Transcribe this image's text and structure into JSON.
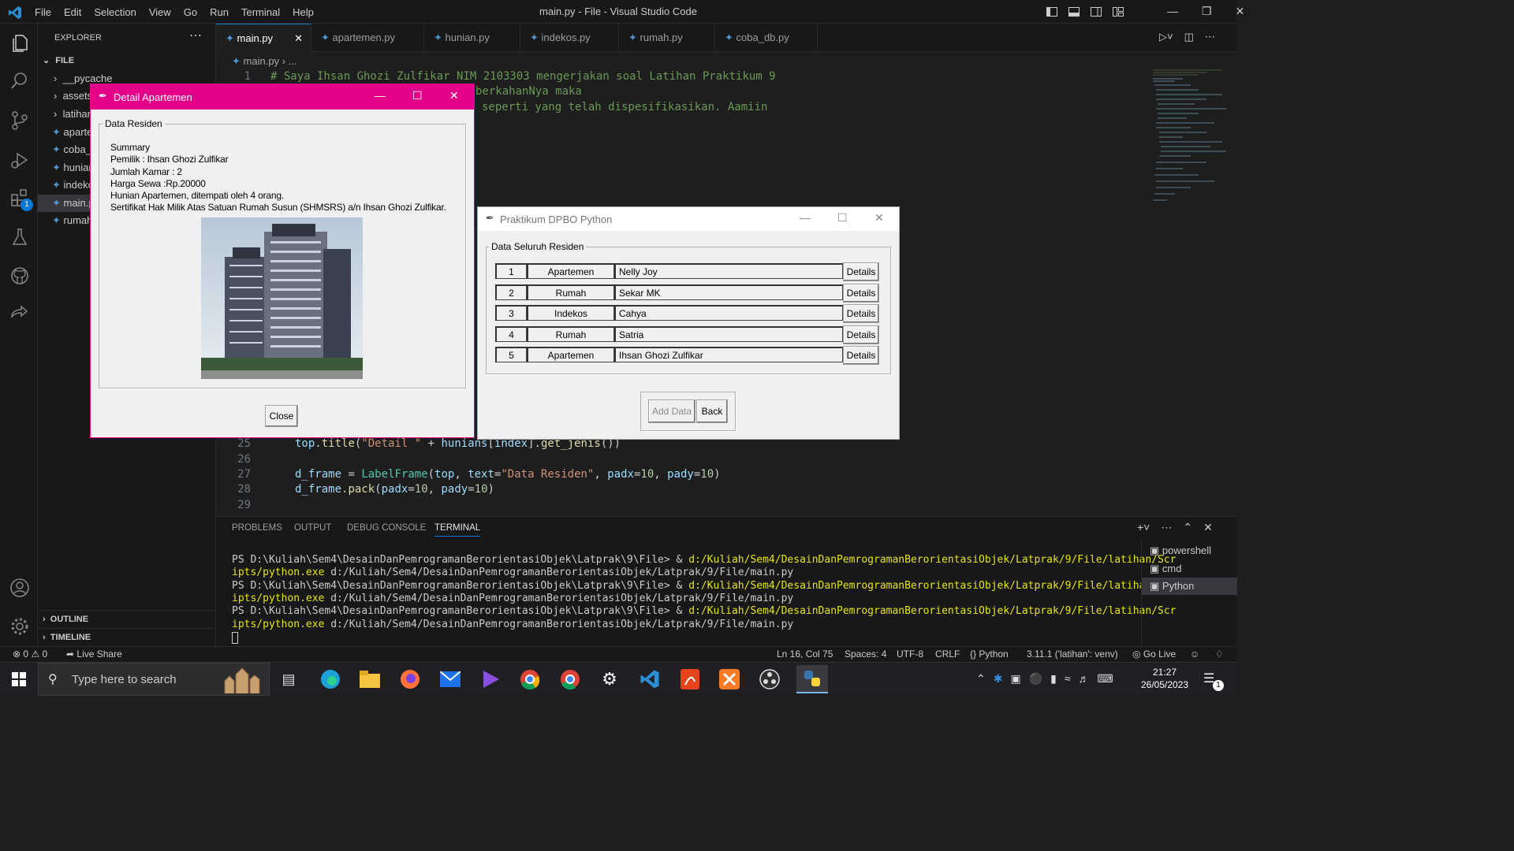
{
  "window": {
    "title": "main.py - File - Visual Studio Code"
  },
  "menu": [
    "File",
    "Edit",
    "Selection",
    "View",
    "Go",
    "Run",
    "Terminal",
    "Help"
  ],
  "sidebar": {
    "title": "EXPLORER",
    "section": "FILE",
    "items": [
      "__pycache",
      "assets",
      "latihan",
      "apartemen.py",
      "coba_db.py",
      "hunian.py",
      "indekos.py",
      "main.py",
      "rumah.py"
    ],
    "outline": "OUTLINE",
    "timeline": "TIMELINE"
  },
  "tabs": [
    "main.py",
    "apartemen.py",
    "hunian.py",
    "indekos.py",
    "rumah.py",
    "coba_db.py"
  ],
  "breadcrumb": [
    "main.py",
    "..."
  ],
  "code_top": [
    {
      "n": "1",
      "t": "# Saya Ihsan Ghozi Zulfikar NIM 2103303 mengerjakan soal Latihan Praktikum 9"
    },
    {
      "n": "",
      "t": "berkahanNya maka"
    },
    {
      "n": "",
      "t": "seperti yang telah dispesifikasikan. Aamiin"
    }
  ],
  "code_bottom": [
    {
      "n": "25",
      "t": "top.title(\"Detail \" + hunians[index].get_jenis())"
    },
    {
      "n": "26",
      "t": ""
    },
    {
      "n": "27",
      "t": "d_frame = LabelFrame(top, text=\"Data Residen\", padx=10, pady=10)"
    },
    {
      "n": "28",
      "t": "d_frame.pack(padx=10, pady=10)"
    },
    {
      "n": "29",
      "t": ""
    }
  ],
  "panel": {
    "tabs": [
      "PROBLEMS",
      "OUTPUT",
      "DEBUG CONSOLE",
      "TERMINAL"
    ],
    "terminals": [
      "powershell",
      "cmd",
      "Python"
    ],
    "prompt": "PS D:\\Kuliah\\Sem4\\DesainDanPemrogramanBerorientasiObjek\\Latprak\\9\\File> & ",
    "exe1": "d:/Kuliah/Sem4/DesainDanPemrogramanBerorientasiObjek/Latprak/9/File/latihan/Scr",
    "exe2": "ipts/python.exe",
    "arg": " d:/Kuliah/Sem4/DesainDanPemrogramanBerorientasiObjek/Latprak/9/File/main.py"
  },
  "status": {
    "errors": "0",
    "warnings": "0",
    "liveshare": "Live Share",
    "position": "Ln 16, Col 75",
    "spaces": "Spaces: 4",
    "encoding": "UTF-8",
    "eol": "CRLF",
    "language": "Python",
    "interpreter": "3.11.1 ('latihan': venv)",
    "golive": "Go Live"
  },
  "detail_window": {
    "title": "Detail Apartemen",
    "frame_label": "Data Residen",
    "lines": [
      "Summary",
      "Pemilik : Ihsan Ghozi Zulfikar",
      "Jumlah Kamar : 2",
      "Harga Sewa :Rp.20000",
      "Hunian Apartemen, ditempati oleh 4 orang.",
      "Sertifikat Hak Milik Atas Satuan Rumah Susun (SHMSRS) a/n Ihsan Ghozi Zulfikar."
    ],
    "close": "Close"
  },
  "main_window": {
    "title": "Praktikum DPBO Python",
    "frame_label": "Data Seluruh Residen",
    "rows": [
      {
        "no": "1",
        "jenis": "Apartemen",
        "nama": "Nelly Joy"
      },
      {
        "no": "2",
        "jenis": "Rumah",
        "nama": "Sekar MK"
      },
      {
        "no": "3",
        "jenis": "Indekos",
        "nama": "Cahya"
      },
      {
        "no": "4",
        "jenis": "Rumah",
        "nama": "Satria"
      },
      {
        "no": "5",
        "jenis": "Apartemen",
        "nama": "Ihsan Ghozi Zulfikar"
      }
    ],
    "details_label": "Details",
    "add": "Add Data",
    "back": "Back"
  },
  "taskbar": {
    "search": "Type here to search",
    "time": "21:27",
    "date": "26/05/2023"
  },
  "badge": "1",
  "colors": {
    "accent": "#0078d4",
    "detail_title": "#e5008a",
    "comment": "#6a9955",
    "string": "#ce9178",
    "func": "#dcdcaa",
    "var": "#9cdcfe",
    "class": "#4ec9b0",
    "exe": "#e5e510"
  }
}
